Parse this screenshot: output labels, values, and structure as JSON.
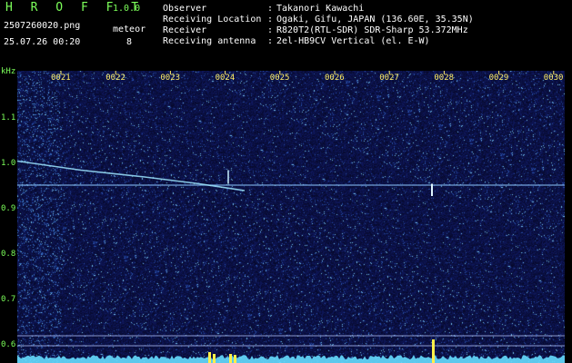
{
  "header": {
    "app_title": "H R O F F T",
    "app_version": "1.0.0",
    "file_name": "2507260020.png",
    "date_time": "25.07.26 00:20",
    "meteor_label": "meteor",
    "meteor_count": "8"
  },
  "info": [
    {
      "label": "Observer",
      "value": "Takanori Kawachi"
    },
    {
      "label": "Receiving Location",
      "value": "Ogaki, Gifu, JAPAN (136.60E, 35.35N)"
    },
    {
      "label": "Receiver",
      "value": "R820T2(RTL-SDR) SDR-Sharp 53.372MHz"
    },
    {
      "label": "Receiving antenna",
      "value": "2el-HB9CV Vertical (el. E-W)"
    }
  ],
  "info_separator": ":",
  "axis": {
    "y_unit": "kHz",
    "x_ticks": [
      "0021",
      "0022",
      "0023",
      "0024",
      "0025",
      "0026",
      "0027",
      "0028",
      "0029",
      "0030"
    ],
    "y_ticks": [
      "1.1",
      "1.0",
      "0.9",
      "0.8",
      "0.7",
      "0.6"
    ],
    "y_range": [
      0.575,
      1.2
    ],
    "x_range": [
      20.6,
      30.6
    ]
  },
  "colors": {
    "background": "#000000",
    "plot_bg": "#070b4a",
    "grid_marker": "#ffee66",
    "label_green": "#7cff5a",
    "trace": "#66ddff"
  }
}
